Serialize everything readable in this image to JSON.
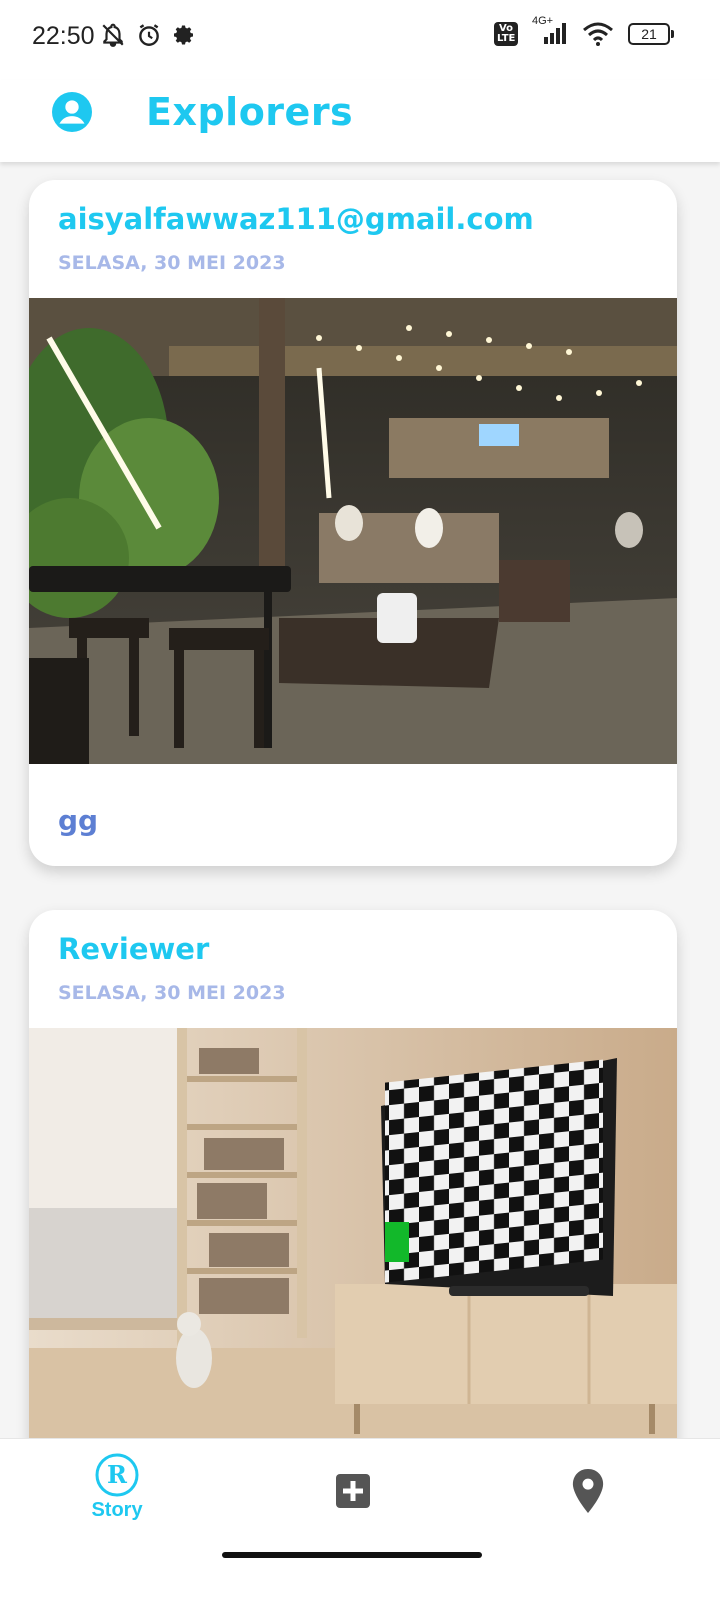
{
  "status_bar": {
    "time": "22:50",
    "network": "4G+",
    "volte": "Vo LTE",
    "battery": "21"
  },
  "app_bar": {
    "title": "Explorers",
    "profile_icon": "account-circle-icon"
  },
  "posts": [
    {
      "user": "aisyalfawwaz111@gmail.com",
      "date": "SELASA, 30 MEI 2023",
      "caption": "gg"
    },
    {
      "user": "Reviewer",
      "date": "SELASA, 30 MEI 2023"
    }
  ],
  "bottom_nav": {
    "story_label": "Story",
    "story_icon": "story-logo-icon",
    "add_icon": "add-box-icon",
    "map_icon": "location-pin-icon"
  },
  "colors": {
    "accent": "#1ec8f0",
    "date": "#a7b8e8",
    "caption": "#5d7fd3"
  }
}
